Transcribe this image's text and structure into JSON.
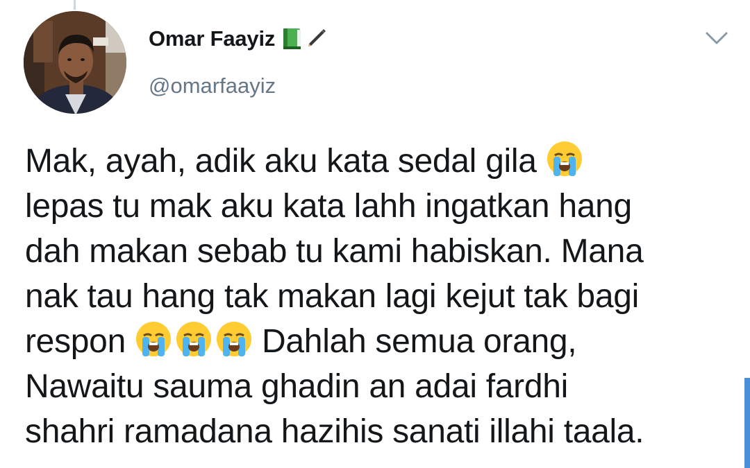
{
  "author": {
    "name": "Omar Faayiz",
    "handle": "@omarfaayiz",
    "name_emojis": [
      "green-book-icon",
      "pencil-icon"
    ],
    "avatar": "avatar"
  },
  "menu": {
    "caret_icon": "chevron-down-icon"
  },
  "tweet": {
    "lines": [
      {
        "text": "Mak, ayah, adik aku kata sedal gila ",
        "emojis": 1
      },
      {
        "text": "lepas tu mak aku kata lahh ingatkan hang"
      },
      {
        "text": "dah makan sebab tu kami habiskan. Mana"
      },
      {
        "text": "nak tau hang tak makan lagi kejut tak bagi"
      },
      {
        "text_before": "respon ",
        "emojis": 3,
        "text_after": " Dahlah semua orang,"
      },
      {
        "text": "Nawaitu sauma ghadin an adai fardhi"
      },
      {
        "text": "shahri ramadana hazihis sanati illahi taala."
      }
    ],
    "emoji_name": "loudly-crying-face-icon"
  },
  "colors": {
    "text": "#14171a",
    "secondary": "#657786",
    "accent": "#4a90d9"
  }
}
